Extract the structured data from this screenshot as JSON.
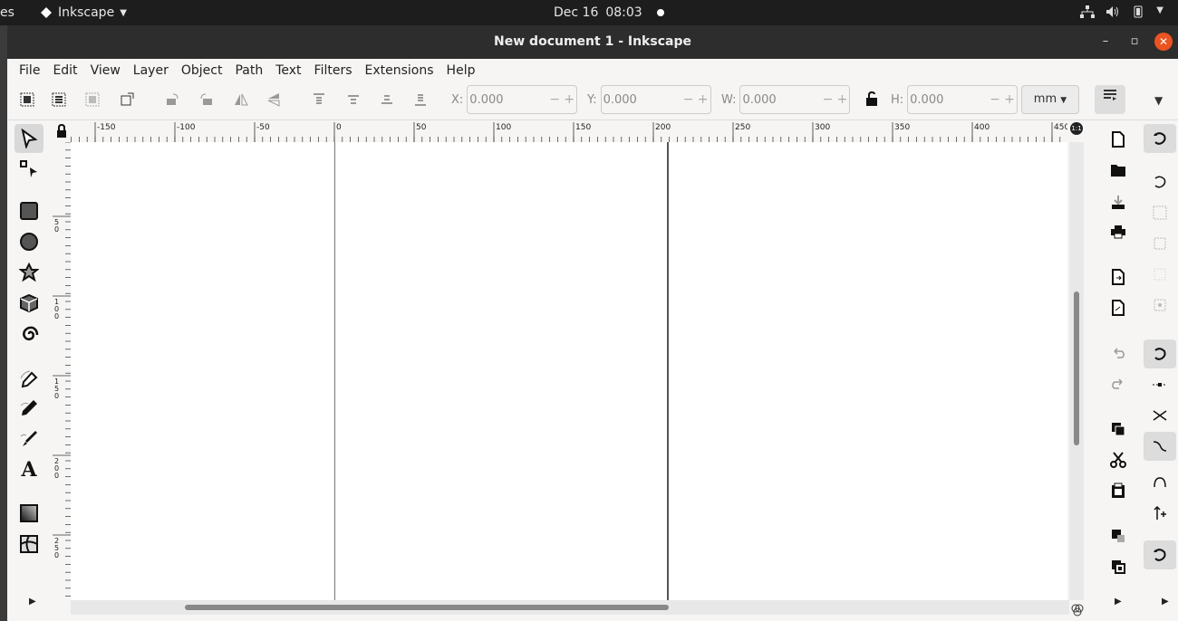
{
  "topbar": {
    "activities": "es",
    "app_name": "Inkscape",
    "date": "Dec 16",
    "time": "08:03"
  },
  "window": {
    "title": "New document 1 - Inkscape"
  },
  "menubar": {
    "items": [
      "File",
      "Edit",
      "View",
      "Layer",
      "Object",
      "Path",
      "Text",
      "Filters",
      "Extensions",
      "Help"
    ]
  },
  "toolbar": {
    "x_label": "X:",
    "x_value": "0.000",
    "y_label": "Y:",
    "y_value": "0.000",
    "w_label": "W:",
    "w_value": "0.000",
    "h_label": "H:",
    "h_value": "0.000",
    "unit": "mm"
  },
  "ruler": {
    "top_labels": [
      "-150",
      "-100",
      "-50",
      "0",
      "50",
      "100",
      "150",
      "200",
      "250",
      "300",
      "350",
      "400",
      "450"
    ],
    "left_labels": [
      "50",
      "100",
      "150",
      "200",
      "250"
    ]
  },
  "zoom_corner": "1:1",
  "tools": [
    "selector-tool",
    "node-tool",
    "rectangle-tool",
    "ellipse-tool",
    "star-tool",
    "3d-box-tool",
    "spiral-tool",
    "pen-tool",
    "pencil-tool",
    "calligraphy-tool",
    "text-tool",
    "gradient-tool",
    "mesh-tool"
  ],
  "commands": [
    "new-document",
    "open-document",
    "save-document",
    "print-document",
    "import",
    "export",
    "undo",
    "redo",
    "copy",
    "cut",
    "paste",
    "duplicate",
    "clone"
  ],
  "snap_controls": [
    "snap-toggle",
    "snap-bbox",
    "snap-bbox-edge",
    "snap-bbox-corner",
    "snap-bbox-midpoint",
    "snap-bbox-center",
    "snap-nodes",
    "snap-path",
    "snap-intersection",
    "snap-cusp",
    "snap-smooth",
    "snap-others",
    "snap-page"
  ]
}
